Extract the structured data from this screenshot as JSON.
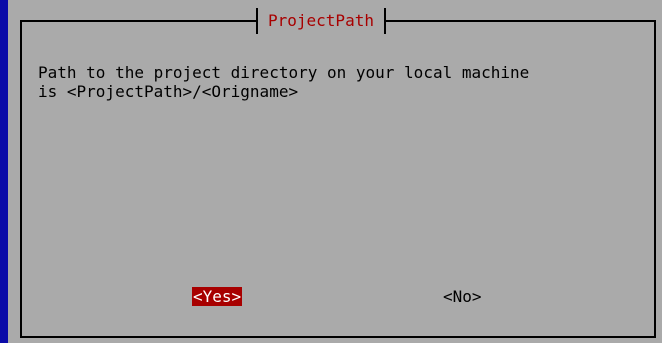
{
  "dialog": {
    "title": "ProjectPath",
    "message_line1": "Path to the project directory on your local machine",
    "message_line2": "is <ProjectPath>/<Origname>",
    "yes_label": "<Yes>",
    "no_label": "<No>"
  },
  "colors": {
    "screen_background": "#0a0aa8",
    "dialog_background": "#aaaaaa",
    "title_color": "#a80000",
    "focused_button_background": "#a80000",
    "focused_button_text": "#ffffff"
  }
}
